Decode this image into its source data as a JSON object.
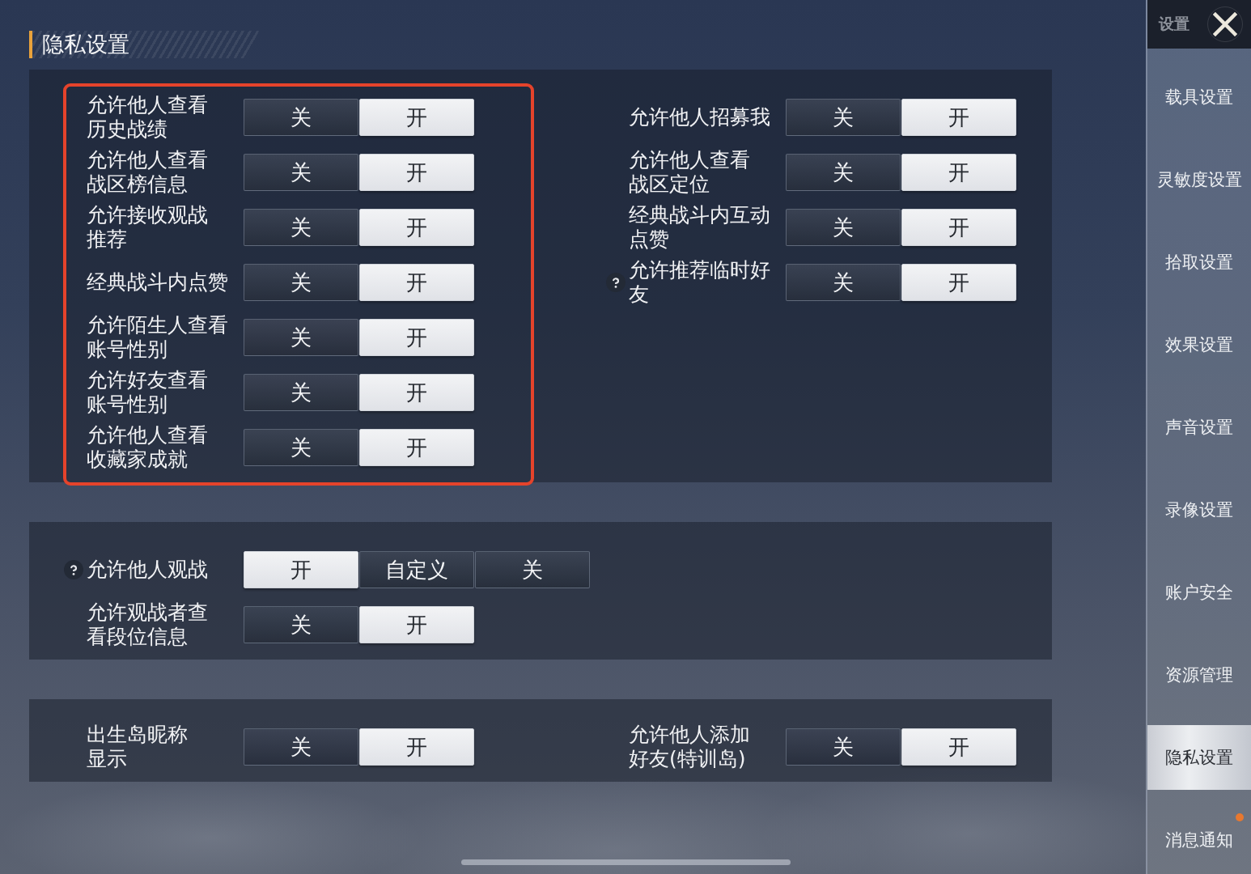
{
  "page_title": "隐私设置",
  "sections": [
    {
      "columns": [
        {
          "highlighted": true,
          "rows": [
            {
              "label_lines": [
                "允许他人查看",
                "历史战绩"
              ],
              "help": false,
              "options": [
                {
                  "text": "关",
                  "selected": false
                },
                {
                  "text": "开",
                  "selected": true
                }
              ]
            },
            {
              "label_lines": [
                "允许他人查看",
                "战区榜信息"
              ],
              "help": false,
              "options": [
                {
                  "text": "关",
                  "selected": false
                },
                {
                  "text": "开",
                  "selected": true
                }
              ]
            },
            {
              "label_lines": [
                "允许接收观战",
                "推荐"
              ],
              "help": false,
              "options": [
                {
                  "text": "关",
                  "selected": false
                },
                {
                  "text": "开",
                  "selected": true
                }
              ]
            },
            {
              "label_lines": [
                "经典战斗内点赞"
              ],
              "help": false,
              "options": [
                {
                  "text": "关",
                  "selected": false
                },
                {
                  "text": "开",
                  "selected": true
                }
              ]
            },
            {
              "label_lines": [
                "允许陌生人查看",
                "账号性别"
              ],
              "help": false,
              "options": [
                {
                  "text": "关",
                  "selected": false
                },
                {
                  "text": "开",
                  "selected": true
                }
              ]
            },
            {
              "label_lines": [
                "允许好友查看",
                "账号性别"
              ],
              "help": false,
              "options": [
                {
                  "text": "关",
                  "selected": false
                },
                {
                  "text": "开",
                  "selected": true
                }
              ]
            },
            {
              "label_lines": [
                "允许他人查看",
                "收藏家成就"
              ],
              "help": false,
              "options": [
                {
                  "text": "关",
                  "selected": false
                },
                {
                  "text": "开",
                  "selected": true
                }
              ]
            }
          ]
        },
        {
          "highlighted": false,
          "rows": [
            {
              "label_lines": [
                "允许他人招募我"
              ],
              "help": false,
              "options": [
                {
                  "text": "关",
                  "selected": false
                },
                {
                  "text": "开",
                  "selected": true
                }
              ]
            },
            {
              "label_lines": [
                "允许他人查看",
                "战区定位"
              ],
              "help": false,
              "options": [
                {
                  "text": "关",
                  "selected": false
                },
                {
                  "text": "开",
                  "selected": true
                }
              ]
            },
            {
              "label_lines": [
                "经典战斗内互动",
                "点赞"
              ],
              "help": false,
              "options": [
                {
                  "text": "关",
                  "selected": false
                },
                {
                  "text": "开",
                  "selected": true
                }
              ]
            },
            {
              "label_lines": [
                "允许推荐临时好",
                "友"
              ],
              "help": true,
              "options": [
                {
                  "text": "关",
                  "selected": false
                },
                {
                  "text": "开",
                  "selected": true
                }
              ]
            }
          ]
        }
      ]
    },
    {
      "columns": [
        {
          "highlighted": false,
          "rows": [
            {
              "label_lines": [
                "允许他人观战"
              ],
              "help": true,
              "options": [
                {
                  "text": "开",
                  "selected": true
                },
                {
                  "text": "自定义",
                  "selected": false
                },
                {
                  "text": "关",
                  "selected": false
                }
              ]
            },
            {
              "label_lines": [
                "允许观战者查",
                "看段位信息"
              ],
              "help": false,
              "options": [
                {
                  "text": "关",
                  "selected": false
                },
                {
                  "text": "开",
                  "selected": true
                }
              ]
            }
          ]
        }
      ]
    },
    {
      "columns": [
        {
          "highlighted": false,
          "rows": [
            {
              "label_lines": [
                "出生岛昵称",
                "显示"
              ],
              "help": false,
              "options": [
                {
                  "text": "关",
                  "selected": false
                },
                {
                  "text": "开",
                  "selected": true
                }
              ]
            }
          ]
        },
        {
          "highlighted": false,
          "rows": [
            {
              "label_lines": [
                "允许他人添加",
                "好友(特训岛)"
              ],
              "help": false,
              "options": [
                {
                  "text": "关",
                  "selected": false
                },
                {
                  "text": "开",
                  "selected": true
                }
              ]
            }
          ]
        }
      ]
    }
  ],
  "sidebar": {
    "title": "设置",
    "items": [
      {
        "label": "载具设置",
        "selected": false,
        "badge": false
      },
      {
        "label": "灵敏度设置",
        "selected": false,
        "badge": false
      },
      {
        "label": "拾取设置",
        "selected": false,
        "badge": false
      },
      {
        "label": "效果设置",
        "selected": false,
        "badge": false
      },
      {
        "label": "声音设置",
        "selected": false,
        "badge": false
      },
      {
        "label": "录像设置",
        "selected": false,
        "badge": false
      },
      {
        "label": "账户安全",
        "selected": false,
        "badge": false
      },
      {
        "label": "资源管理",
        "selected": false,
        "badge": false
      },
      {
        "label": "隐私设置",
        "selected": true,
        "badge": false
      },
      {
        "label": "消息通知",
        "selected": false,
        "badge": true
      }
    ]
  }
}
